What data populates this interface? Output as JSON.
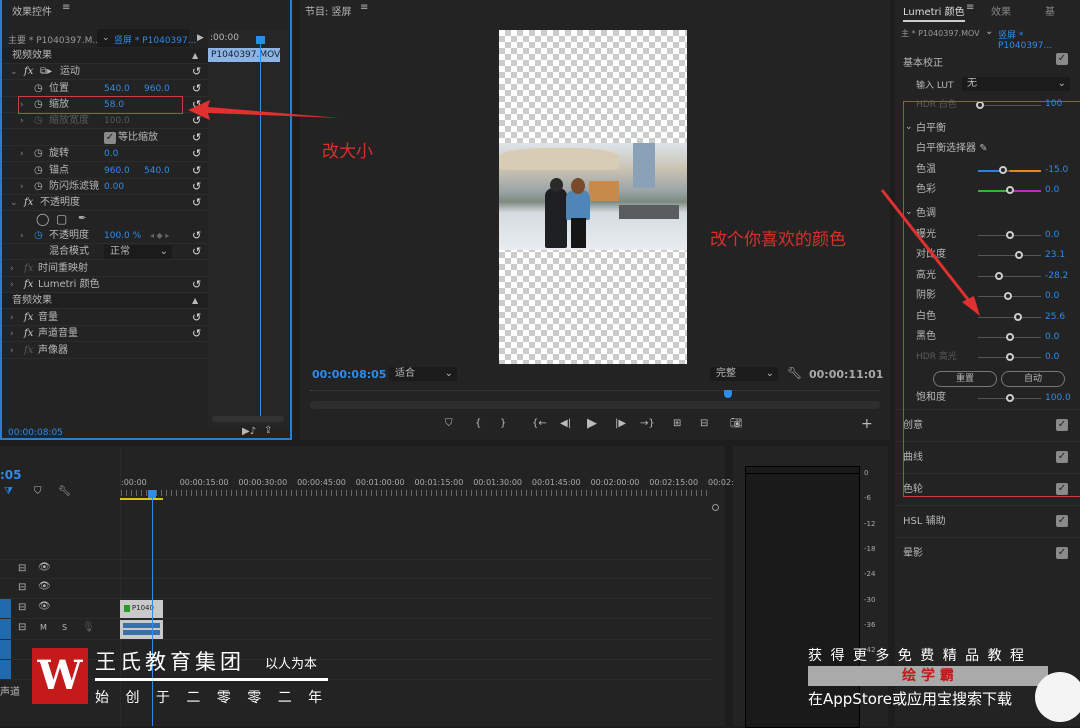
{
  "effects_panel": {
    "title": "效果控件",
    "master_tab": "主要 * P1040397.M...",
    "seq_tab": "竖屏 * P1040397...",
    "mini_time": ":00:00",
    "mini_clip": "P1040397.MOV",
    "timecode": "00:00:08:05",
    "video_effects": "视频效果",
    "motion": "运动",
    "position": "位置",
    "position_x": "540.0",
    "position_y": "960.0",
    "scale": "缩放",
    "scale_val": "58.0",
    "scale_width": "缩放宽度",
    "scale_width_val": "100.0",
    "uniform_scale": "等比缩放",
    "rotation": "旋转",
    "rotation_val": "0.0",
    "anchor": "锚点",
    "anchor_x": "960.0",
    "anchor_y": "540.0",
    "antiflicker": "防闪烁滤镜",
    "antiflicker_val": "0.00",
    "opacity": "不透明度",
    "opacity_label": "不透明度",
    "opacity_val": "100.0 %",
    "blend_mode": "混合模式",
    "blend_val": "正常",
    "time_remap": "时间重映射",
    "lumetri": "Lumetri 颜色",
    "audio_effects": "音频效果",
    "volume": "音量",
    "channel_volume": "声道音量",
    "panner": "声像器"
  },
  "program": {
    "title": "节目: 竖屏",
    "timecode": "00:00:08:05",
    "fit": "适合",
    "quality": "完整",
    "duration": "00:00:11:01"
  },
  "lumetri": {
    "tabs": [
      "Lumetri 颜色",
      "效果",
      "基"
    ],
    "master_tab": "主 * P1040397.MOV",
    "seq_tab": "竖屏 * P1040397...",
    "basic": "基本校正",
    "input_lut": "输入 LUT",
    "lut_val": "无",
    "hdr_white": "HDR 白色",
    "hdr_white_val": "100",
    "wb": "白平衡",
    "wb_picker": "白平衡选择器",
    "temp": "色温",
    "temp_val": "-15.0",
    "tint": "色彩",
    "tint_val": "0.0",
    "tone": "色调",
    "exposure": "曝光",
    "exposure_val": "0.0",
    "contrast": "对比度",
    "contrast_val": "23.1",
    "highlights": "高光",
    "highlights_val": "-28.2",
    "shadows": "阴影",
    "shadows_val": "0.0",
    "whites": "白色",
    "whites_val": "25.6",
    "blacks": "黑色",
    "blacks_val": "0.0",
    "hdr_spec": "HDR 高光",
    "hdr_spec_val": "0.0",
    "reset": "重置",
    "auto": "自动",
    "saturation": "饱和度",
    "saturation_val": "100.0",
    "creative": "创意",
    "curves": "曲线",
    "wheels": "色轮",
    "hsl": "HSL 辅助",
    "vignette": "晕影"
  },
  "timeline": {
    "timecode": ":05",
    "ruler": [
      ":00:00",
      "00:00:15:00",
      "00:00:30:00",
      "00:00:45:00",
      "00:01:00:00",
      "00:01:15:00",
      "00:01:30:00",
      "00:01:45:00",
      "00:02:00:00",
      "00:02:15:00",
      "00:02:3"
    ],
    "clip": "P1040",
    "track_m": "M",
    "track_s": "S",
    "channel": "声道"
  },
  "meter": {
    "ticks": [
      "0",
      "-6",
      "-12",
      "-18",
      "-24",
      "-30",
      "-36",
      "-42",
      "-48"
    ]
  },
  "annotations": {
    "resize": "改大小",
    "color": "改个你喜欢的颜色"
  },
  "watermark": {
    "brand": "王氏教育集团",
    "motto": "以人为本",
    "founded": "始 创 于 二 零 零 二 年",
    "promo1": "获 得 更 多 免 费 精 品 教 程",
    "promo_app": "绘 学 霸",
    "promo2": "在AppStore或应用宝搜索下载"
  },
  "colors": {
    "accent": "#2d8ceb",
    "annotation": "#d9302c"
  }
}
